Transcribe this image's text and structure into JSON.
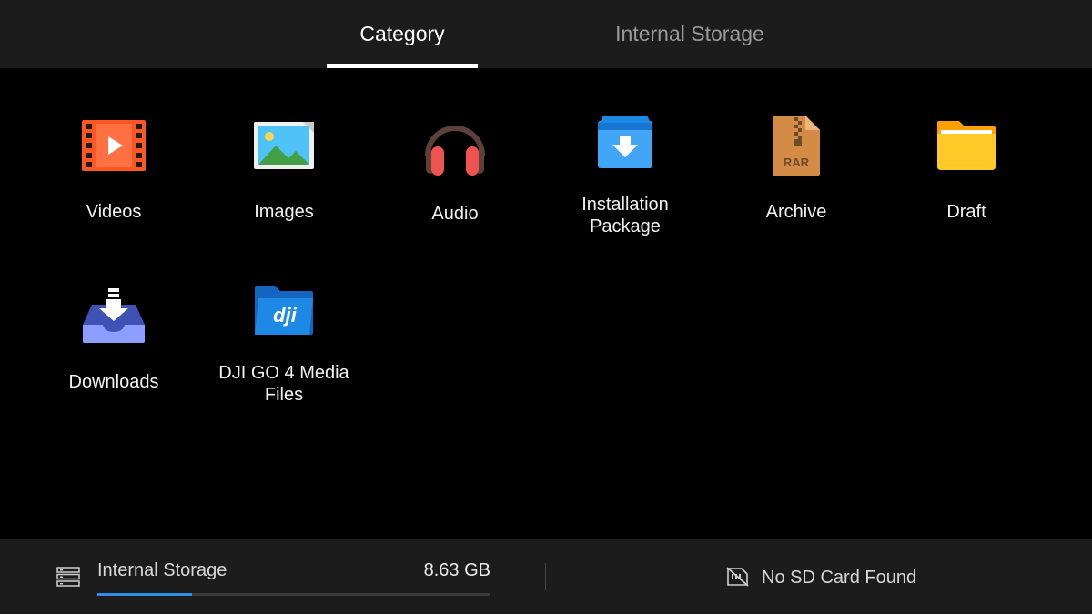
{
  "tabs": [
    {
      "label": "Category",
      "active": true
    },
    {
      "label": "Internal Storage",
      "active": false
    }
  ],
  "categories": [
    {
      "label": "Videos",
      "icon": "video-icon"
    },
    {
      "label": "Images",
      "icon": "image-icon"
    },
    {
      "label": "Audio",
      "icon": "headphones-icon"
    },
    {
      "label": "Installation\nPackage",
      "icon": "package-icon"
    },
    {
      "label": "Archive",
      "icon": "rar-archive-icon",
      "icon_text": "RAR"
    },
    {
      "label": "Draft",
      "icon": "folder-icon"
    },
    {
      "label": "Downloads",
      "icon": "download-tray-icon"
    },
    {
      "label": "DJI GO 4 Media\nFiles",
      "icon": "dji-folder-icon",
      "icon_text": "dji"
    }
  ],
  "storage": {
    "label": "Internal Storage",
    "size": "8.63 GB",
    "used_fraction": 0.24,
    "accent_color": "#2e8ee6"
  },
  "sd_card": {
    "status": "No SD Card Found",
    "icon": "no-sd-card-icon"
  }
}
